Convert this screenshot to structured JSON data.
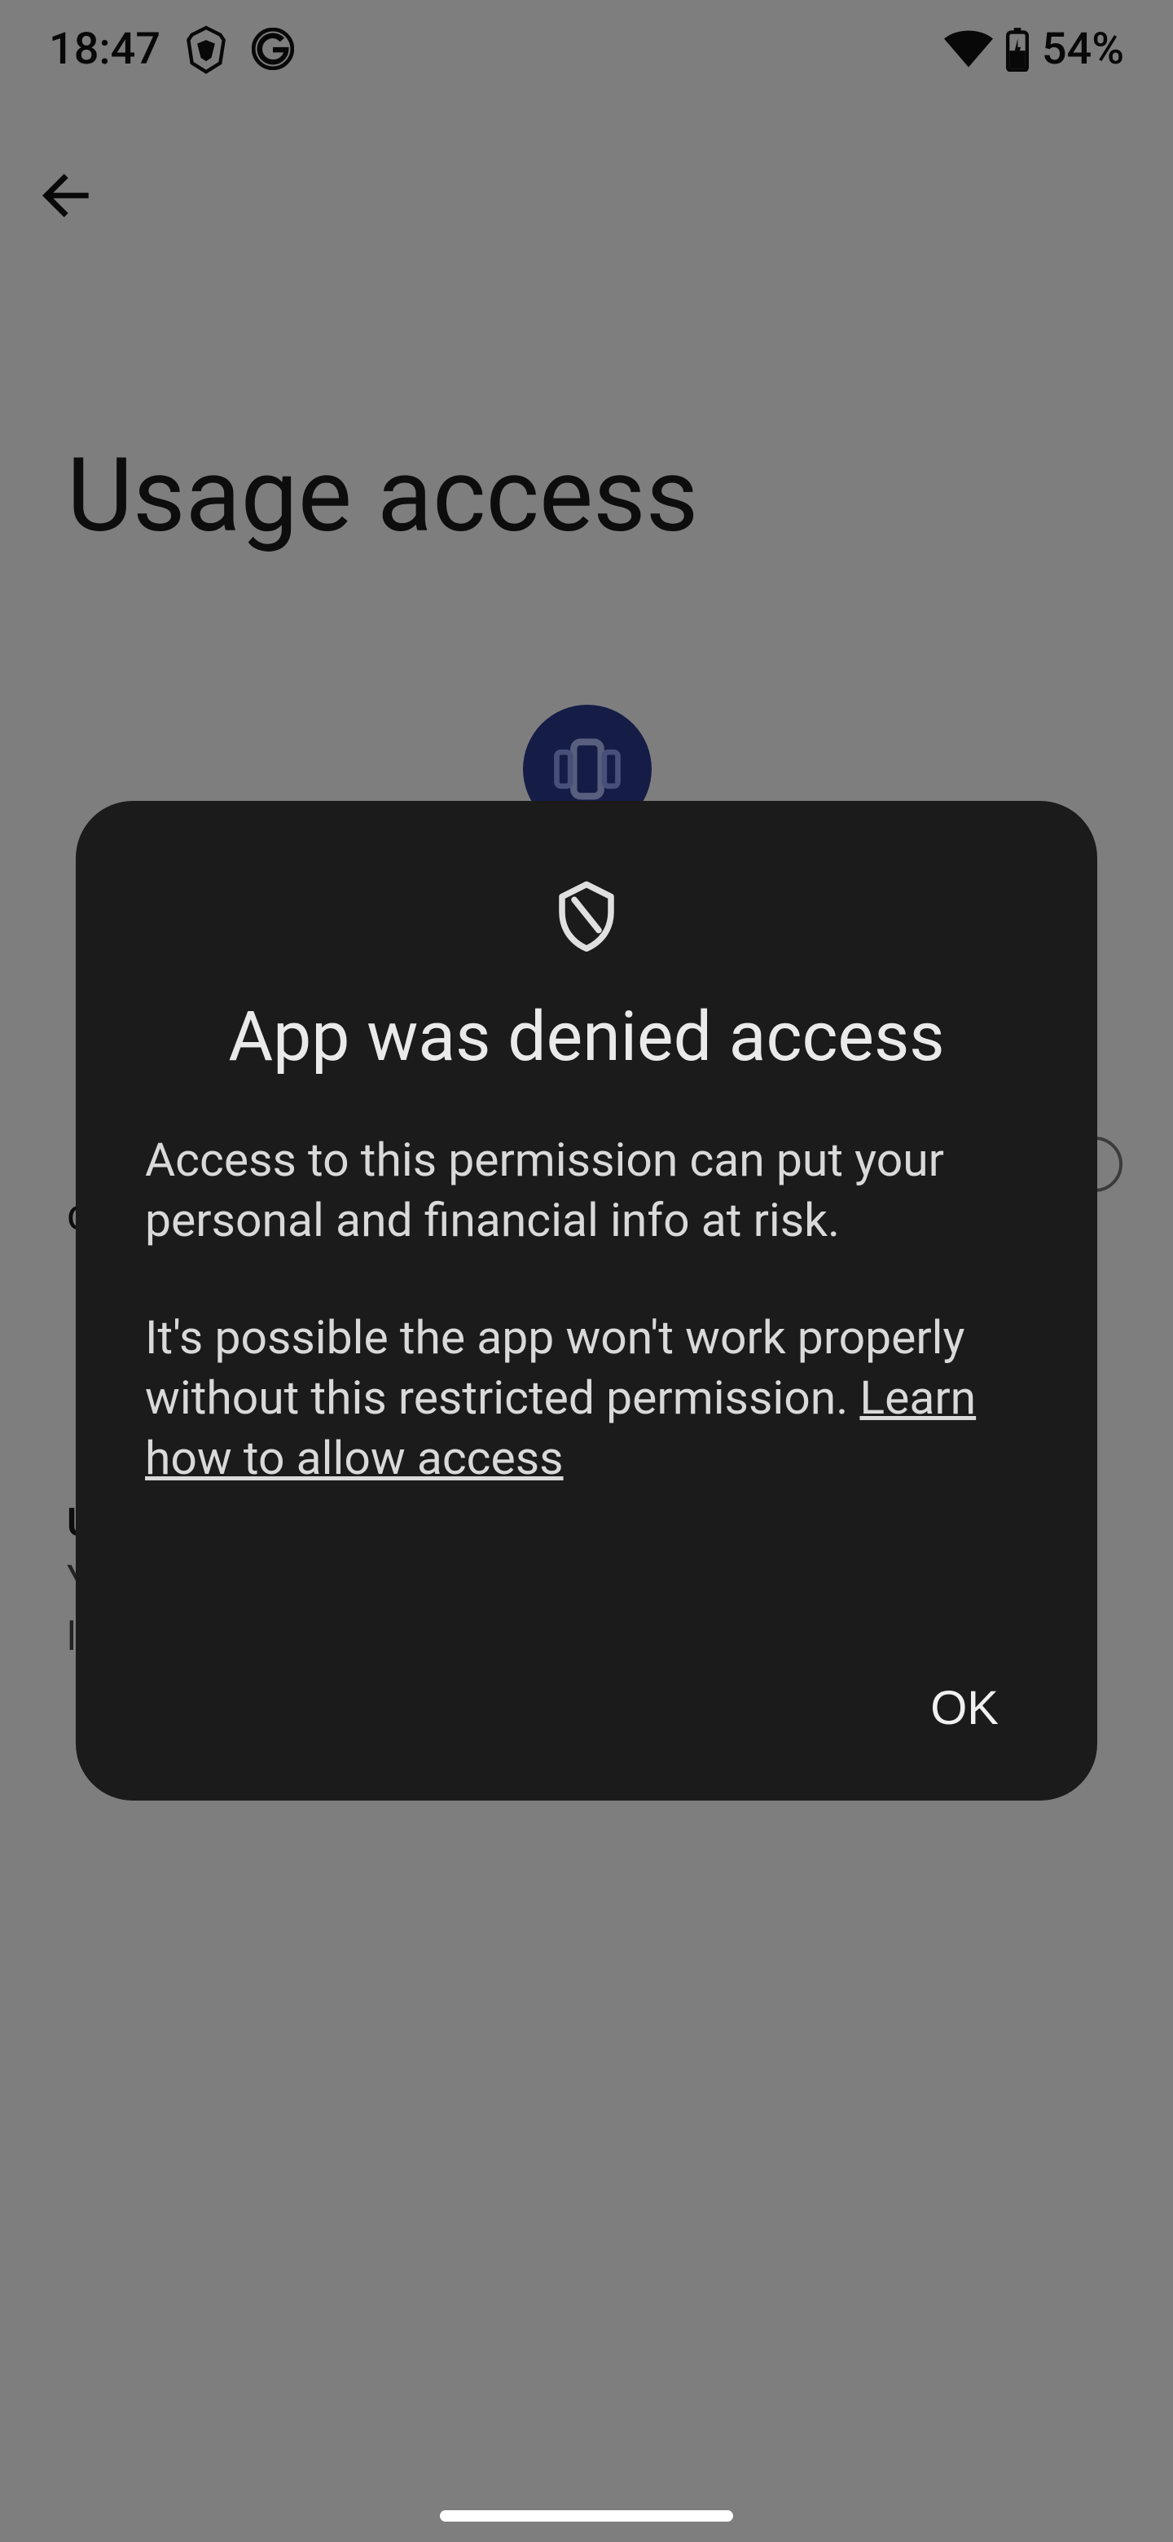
{
  "status_bar": {
    "time": "18:47",
    "battery": "54%"
  },
  "background_page": {
    "title": "Usage access",
    "truncated_label": "c",
    "section_letter1": "U",
    "section_letter2": "Y",
    "section_letter3": "l"
  },
  "dialog": {
    "title": "App was denied access",
    "paragraph1": "Access to this permission can put your personal and financial info at risk.",
    "paragraph2_lead": "It's possible the app won't work properly without this restricted permission. ",
    "learn_more": "Learn how to allow access",
    "ok": "OK"
  }
}
